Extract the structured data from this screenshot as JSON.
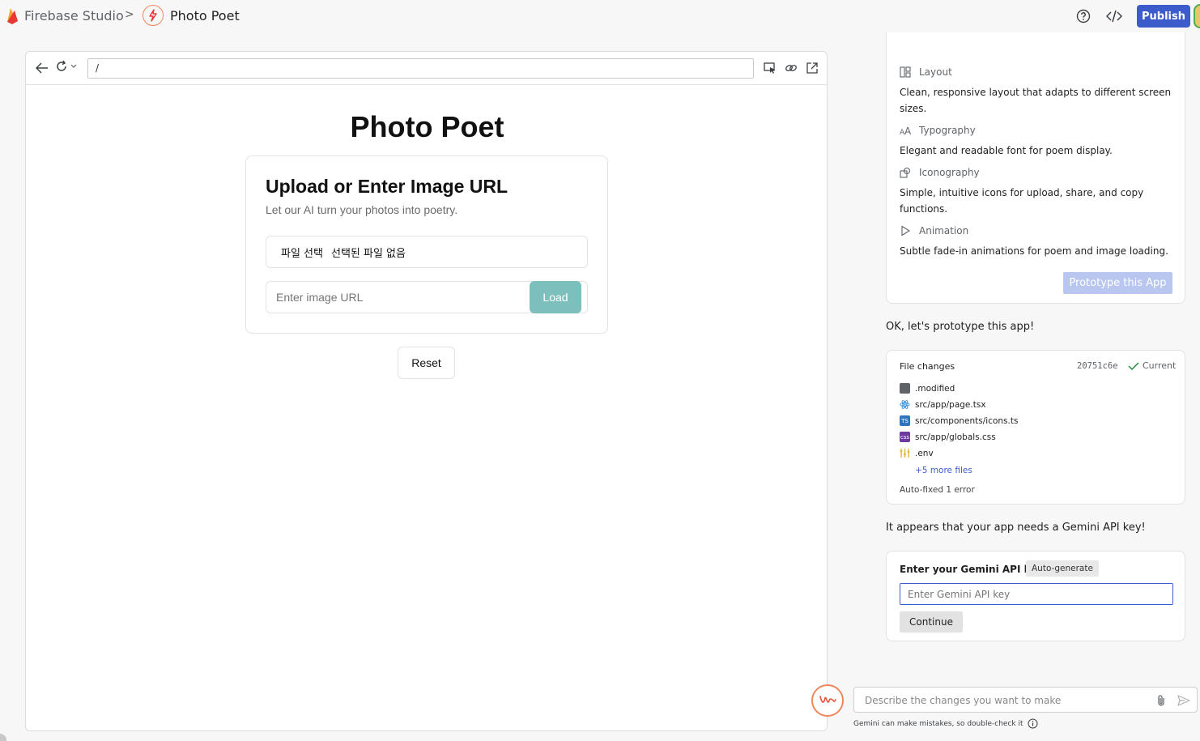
{
  "topbar": {
    "brand": "Firebase Studio",
    "separator": ">",
    "project": "Photo Poet",
    "publish_label": "Publish"
  },
  "browser": {
    "url": "/"
  },
  "app": {
    "title": "Photo Poet",
    "card_title": "Upload or Enter Image URL",
    "card_subtitle": "Let our AI turn your photos into poetry.",
    "file_button_label": "파일 선택",
    "file_status": "선택된 파일 없음",
    "url_placeholder": "Enter image URL",
    "load_label": "Load",
    "reset_label": "Reset"
  },
  "guidelines": {
    "items": [
      {
        "heading": "Layout",
        "text": "Clean, responsive layout that adapts to different screen sizes."
      },
      {
        "heading": "Typography",
        "text": "Elegant and readable font for poem display."
      },
      {
        "heading": "Iconography",
        "text": "Simple, intuitive icons for upload, share, and copy functions."
      },
      {
        "heading": "Animation",
        "text": "Subtle fade-in animations for poem and image loading."
      }
    ],
    "prototype_label": "Prototype this App"
  },
  "chat": {
    "msg_prototype": "OK, let's prototype this app!",
    "msg_api_key": "It appears that your app needs a Gemini API key!",
    "input_placeholder": "Describe the changes you want to make",
    "disclaimer": "Gemini can make mistakes, so double-check it"
  },
  "file_changes": {
    "title": "File changes",
    "commit": "20751c6e",
    "status": "Current",
    "files": [
      {
        "name": ".modified",
        "icon": "file-icon"
      },
      {
        "name": "src/app/page.tsx",
        "icon": "react-icon"
      },
      {
        "name": "src/components/icons.ts",
        "icon": "typescript-icon"
      },
      {
        "name": "src/app/globals.css",
        "icon": "css-icon"
      },
      {
        "name": ".env",
        "icon": "env-icon"
      }
    ],
    "more": "+5 more files",
    "note": "Auto-fixed 1 error"
  },
  "api_key": {
    "title": "Enter your Gemini API key",
    "autogen_label": "Auto-generate",
    "placeholder": "Enter Gemini API key",
    "continue_label": "Continue"
  },
  "colors": {
    "publish": "#3d5ccc",
    "load_button": "#7dbfbc",
    "prototype_button": "#b9c6f0",
    "link": "#3d5ccc",
    "accent_orange": "#f0875a"
  }
}
